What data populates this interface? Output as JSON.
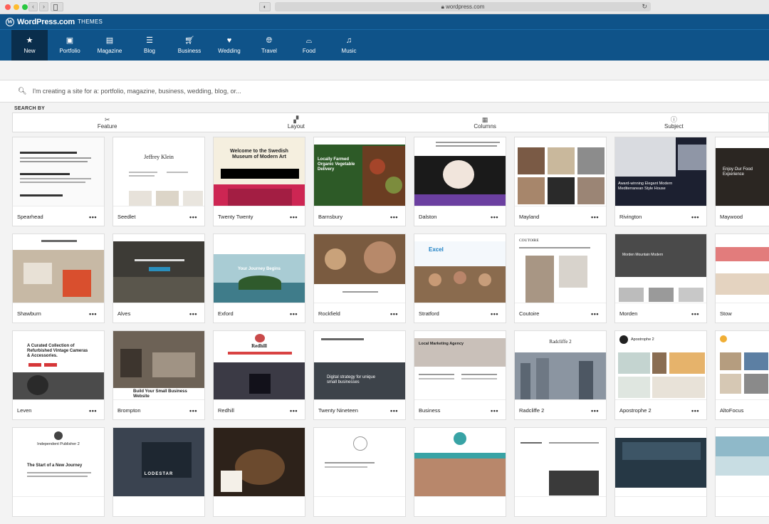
{
  "browser": {
    "url": "wordpress.com"
  },
  "header": {
    "brand": "WordPress.com",
    "section": "THEMES"
  },
  "categories": [
    {
      "label": "New",
      "icon": "star-icon"
    },
    {
      "label": "Portfolio",
      "icon": "portfolio-icon"
    },
    {
      "label": "Magazine",
      "icon": "magazine-icon"
    },
    {
      "label": "Blog",
      "icon": "blog-icon"
    },
    {
      "label": "Business",
      "icon": "cart-icon"
    },
    {
      "label": "Wedding",
      "icon": "heart-icon"
    },
    {
      "label": "Travel",
      "icon": "globe-icon"
    },
    {
      "label": "Food",
      "icon": "food-icon"
    },
    {
      "label": "Music",
      "icon": "music-icon"
    }
  ],
  "search": {
    "placeholder": "I'm creating a site for a: portfolio, magazine, business, wedding, blog, or..."
  },
  "search_by_label": "SEARCH BY",
  "filters": [
    {
      "label": "Feature",
      "icon": "tools-icon"
    },
    {
      "label": "Layout",
      "icon": "layout-icon"
    },
    {
      "label": "Columns",
      "icon": "columns-icon"
    },
    {
      "label": "Subject",
      "icon": "info-icon"
    }
  ],
  "themes": [
    [
      "Spearhead",
      "Seedlet",
      "Twenty Twenty",
      "Barnsbury",
      "Dalston",
      "Mayland",
      "Rivington",
      "Maywood"
    ],
    [
      "Shawburn",
      "Alves",
      "Exford",
      "Rockfield",
      "Stratford",
      "Coutoire",
      "Morden",
      "Stow"
    ],
    [
      "Leven",
      "Brompton",
      "Redhill",
      "Twenty Nineteen",
      "Business",
      "Radcliffe 2",
      "Apostrophe 2",
      "AltoFocus"
    ],
    [
      "",
      "",
      "",
      "",
      "",
      "",
      "",
      ""
    ]
  ],
  "thumb_text": {
    "seedlet": "Jeffrey Klein",
    "twentytwenty": "Welcome to the Swedish Museum of Modern Art",
    "barnsbury": "Locally Farmed Organic Vegetable Delivery",
    "rivington": "Award-winning Elegant Modern Mediterranean Style House",
    "maywood": "Enjoy Our Food Experience",
    "exford": "Your Journey Begins",
    "stratford": "Excel",
    "coutoire": "COUTOIRE",
    "morden": "Morden Mountain Modern",
    "leven": "A Curated Collection of Refurbished Vintage Cameras & Accessories.",
    "brompton": "Build Your Small Business Website",
    "redhill": "Redhill",
    "twentynineteen": "Digital strategy for unique small businesses",
    "business": "Local Marketing Agency",
    "radcliffe": "Radcliffe 2",
    "apostrophe": "Apostrophe 2",
    "lodestar": "LODESTAR",
    "independent": "Independent Publisher 2",
    "independent_post": "The Start of a New Journey"
  },
  "more_label": "•••"
}
